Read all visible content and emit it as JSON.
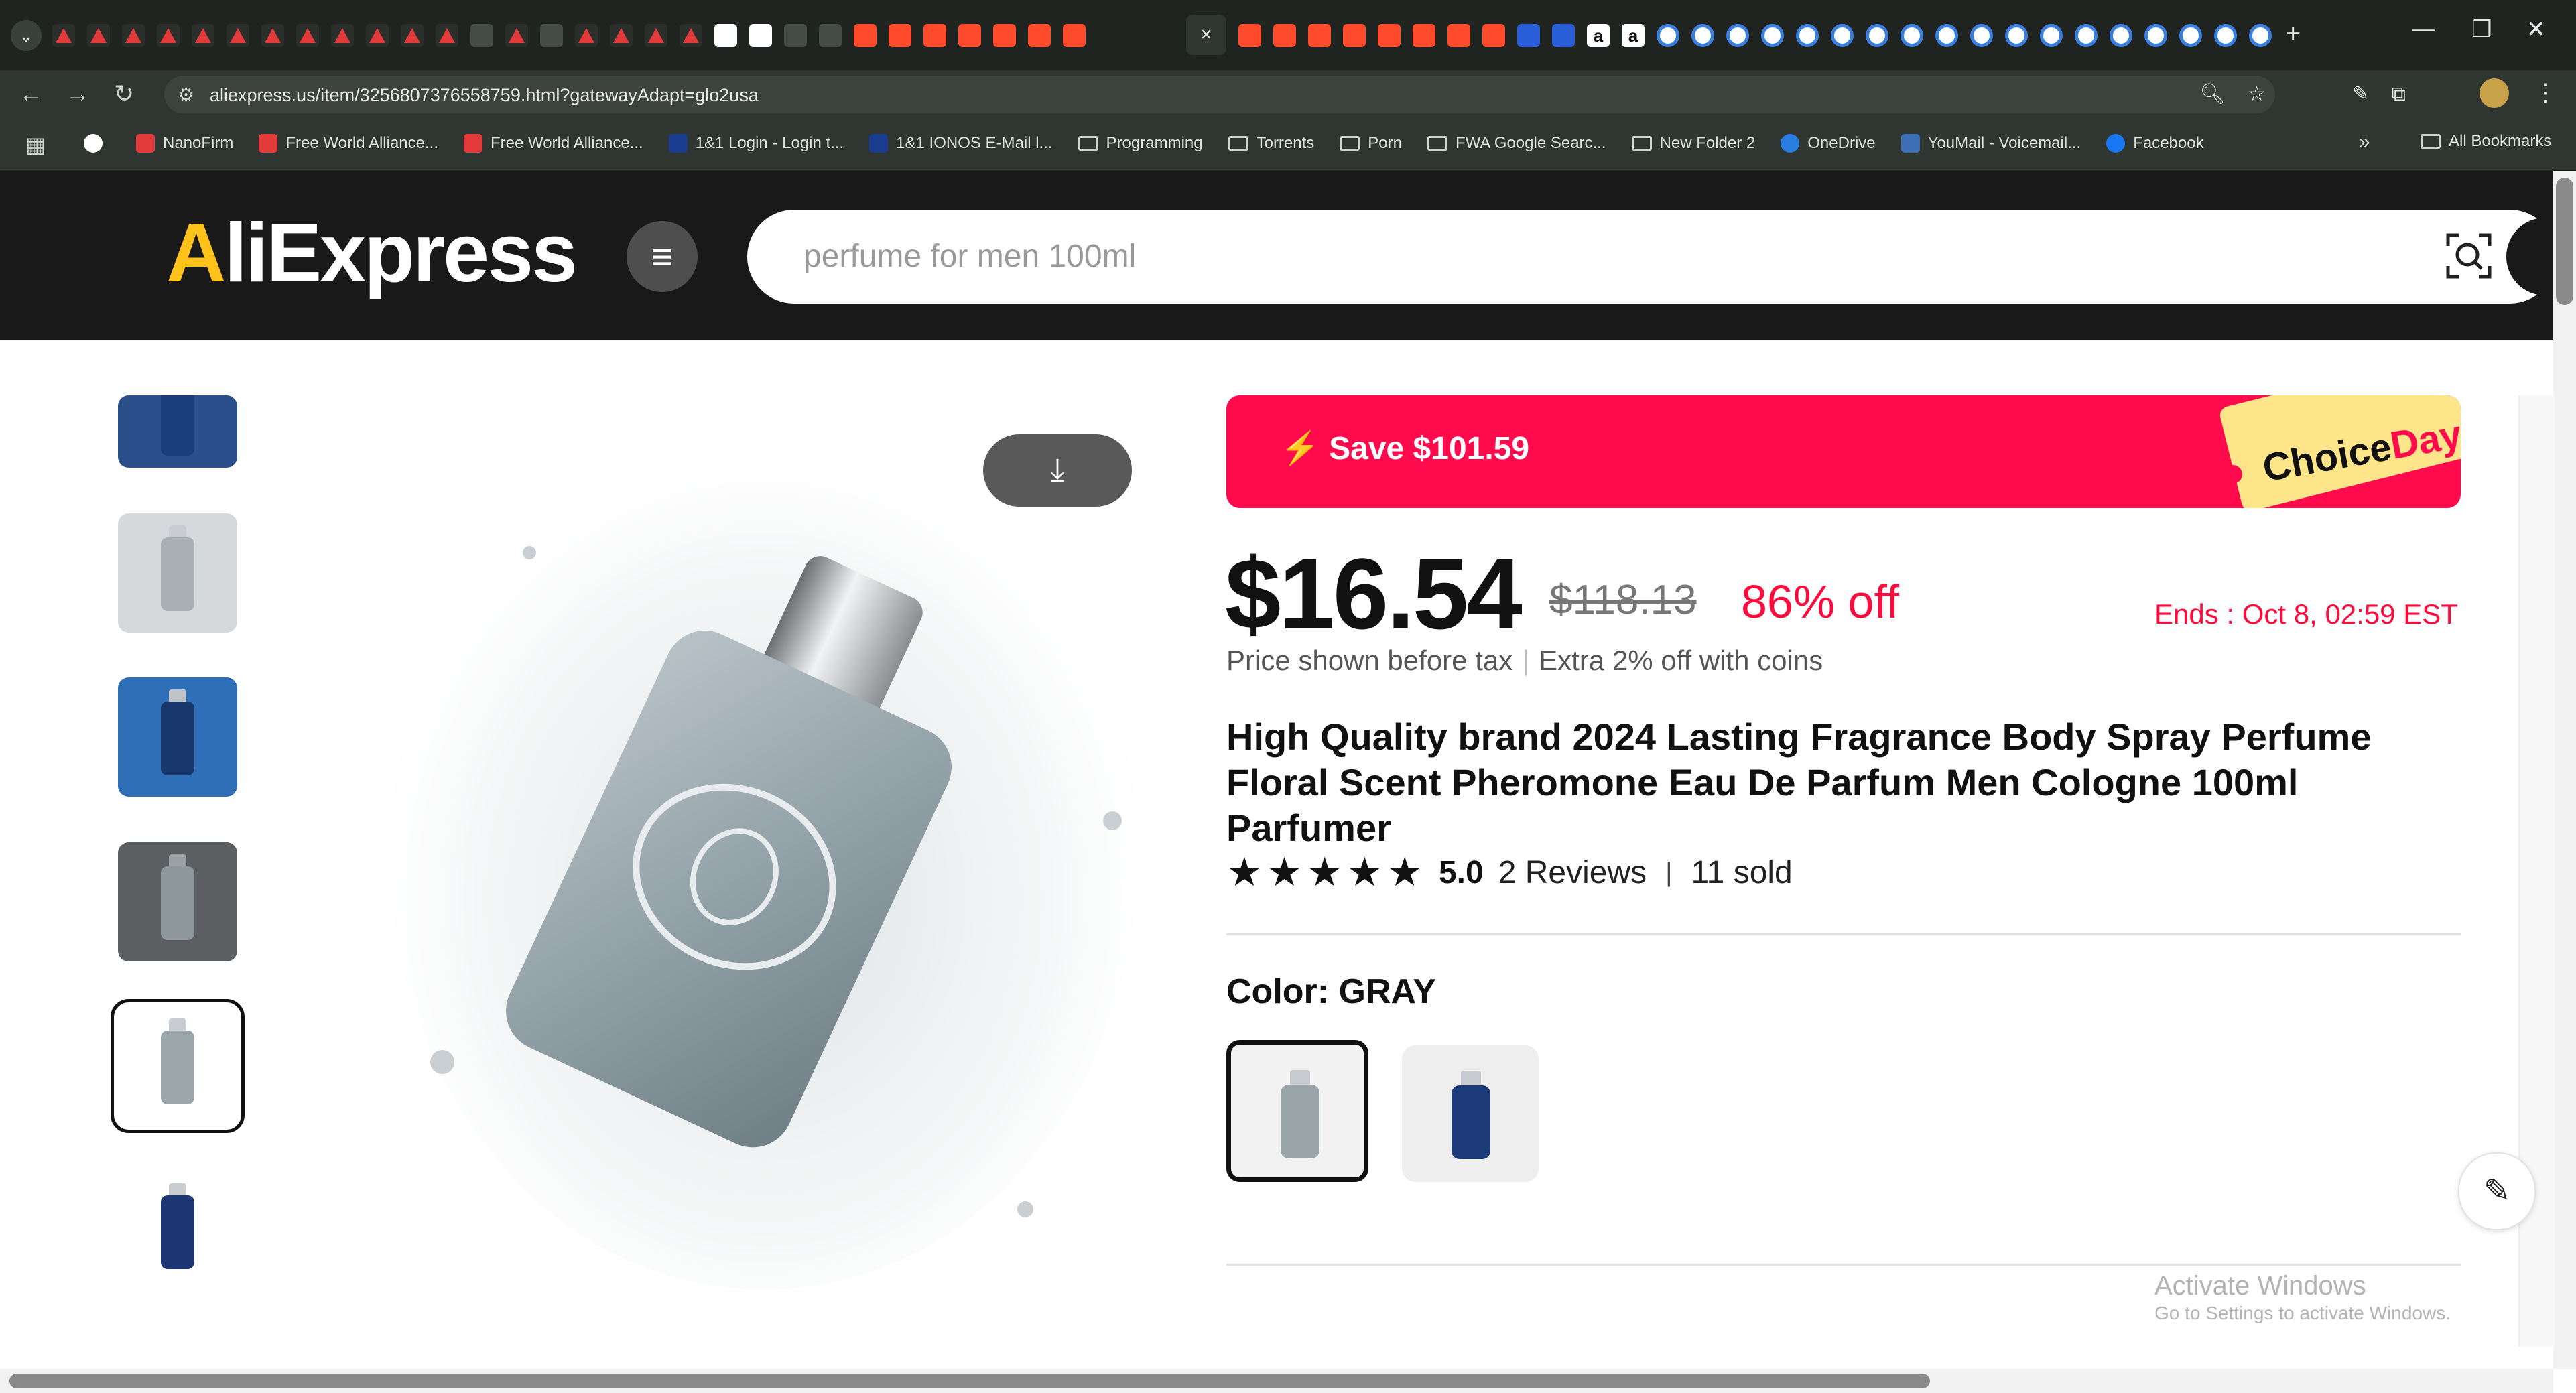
{
  "browser": {
    "tab_close_glyph": "×",
    "new_tab_glyph": "+",
    "url": "aliexpress.us/item/3256807376558759.html?gatewayAdapt=glo2usa",
    "bookmarks": [
      {
        "label": "NanoFirm",
        "icon": "triangle-logo-icon"
      },
      {
        "label": "Free World Alliance...",
        "icon": "triangle-logo-icon"
      },
      {
        "label": "Free World Alliance...",
        "icon": "triangle-logo-icon"
      },
      {
        "label": "1&1 Login - Login t...",
        "icon": "ionos-icon"
      },
      {
        "label": "1&1 IONOS E-Mail l...",
        "icon": "ionos-icon"
      },
      {
        "label": "Programming",
        "icon": "folder-icon"
      },
      {
        "label": "Torrents",
        "icon": "folder-icon"
      },
      {
        "label": "Porn",
        "icon": "folder-icon"
      },
      {
        "label": "FWA Google Searc...",
        "icon": "folder-icon"
      },
      {
        "label": "New Folder 2",
        "icon": "folder-icon"
      },
      {
        "label": "OneDrive",
        "icon": "onedrive-icon"
      },
      {
        "label": "YouMail - Voicemail...",
        "icon": "youmail-icon"
      },
      {
        "label": "Facebook",
        "icon": "facebook-icon"
      }
    ],
    "bookmarks_more": "»",
    "all_bookmarks": "All Bookmarks"
  },
  "site": {
    "logo_a": "A",
    "logo_rest": "liExpress",
    "search_placeholder": "perfume for men 100ml"
  },
  "product": {
    "promo_save": "Save $101.59",
    "promo_choice": "Choice",
    "promo_day": "Day",
    "price": "$16.54",
    "original_price": "$118.13",
    "discount": "86% off",
    "ends": "Ends :  Oct 8, 02:59 EST",
    "price_note": "Price shown before tax",
    "coins_note": "Extra 2% off with coins",
    "title": "High Quality brand 2024 Lasting Fragrance Body Spray Perfume Floral Scent Pheromone Eau De Parfum Men Cologne 100ml Parfumer",
    "rating": "5.0",
    "reviews": "2 Reviews",
    "sold": "11 sold",
    "stars": 5,
    "color_label": "Color: GRAY",
    "colors": [
      "GRAY",
      "BLUE"
    ],
    "accent_color": "#ff0a4d"
  },
  "watermark": {
    "line1": "Activate Windows",
    "line2": "Go to Settings to activate Windows."
  }
}
